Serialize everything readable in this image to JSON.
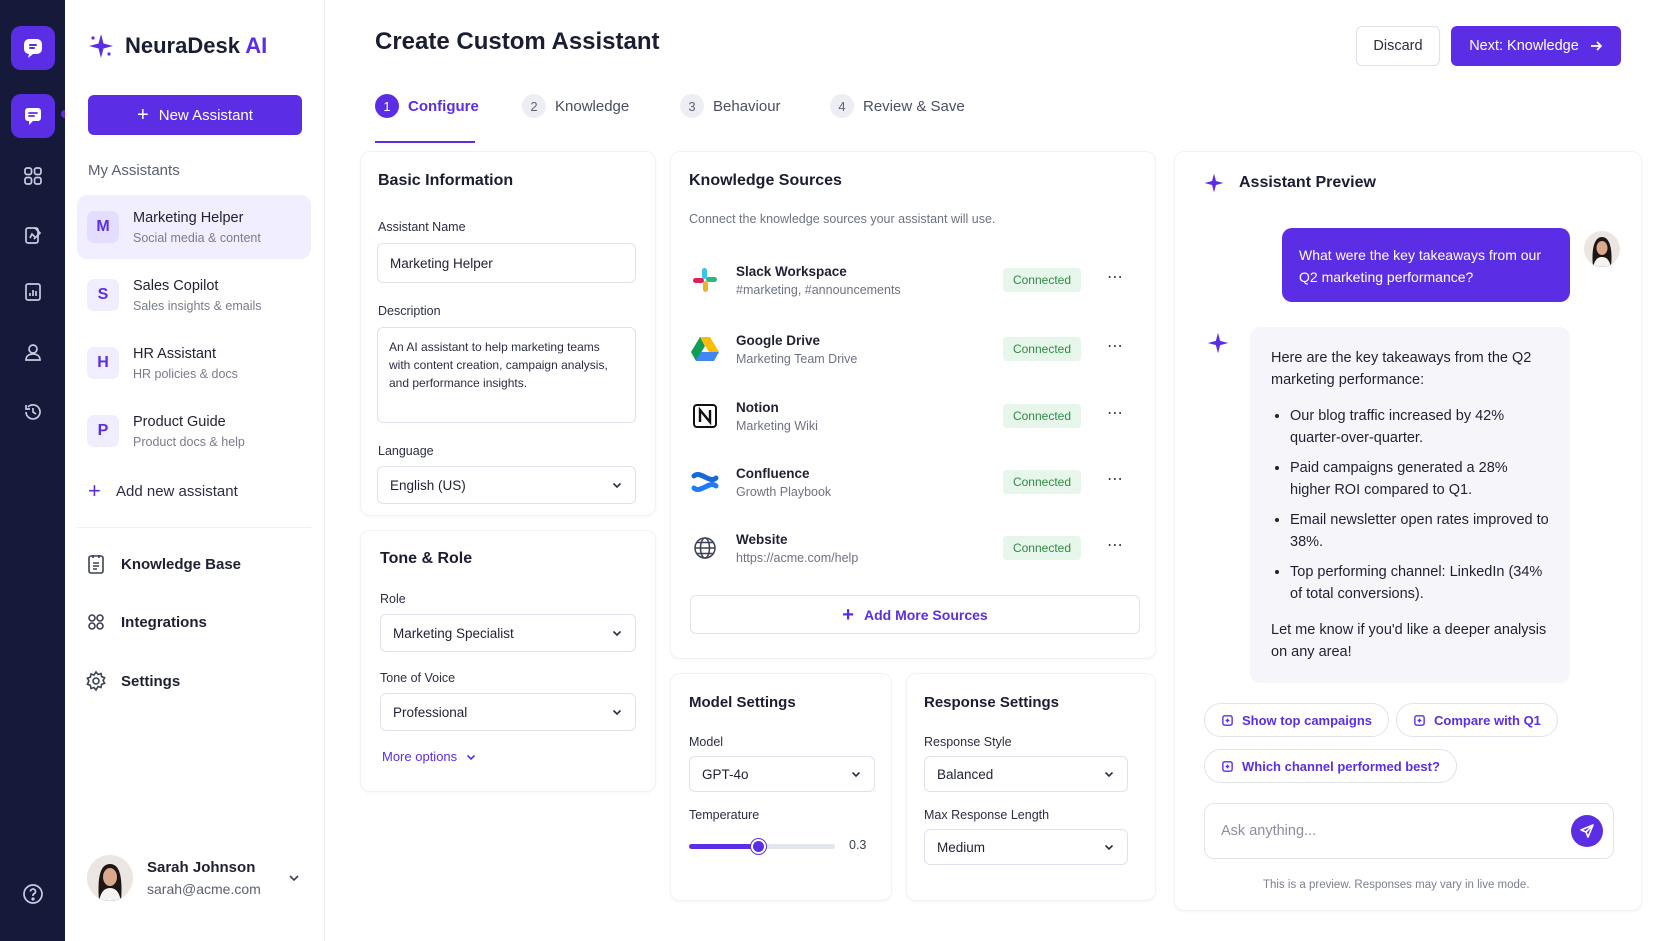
{
  "brand": {
    "name": "NeuraDesk",
    "ai": "AI"
  },
  "sidebar": {
    "new_button": "New Assistant",
    "section_label": "My Assistants",
    "assistants": [
      {
        "initial": "M",
        "name": "Marketing Helper",
        "sub": "Social media & content"
      },
      {
        "initial": "S",
        "name": "Sales Copilot",
        "sub": "Sales insights & emails"
      },
      {
        "initial": "H",
        "name": "HR Assistant",
        "sub": "HR policies & docs"
      },
      {
        "initial": "P",
        "name": "Product Guide",
        "sub": "Product docs & help"
      }
    ],
    "add_assistant": "Add new assistant",
    "nav": [
      "Knowledge Base",
      "Integrations",
      "Settings"
    ],
    "user": {
      "name": "Sarah Johnson",
      "email": "sarah@acme.com"
    }
  },
  "header": {
    "title": "Create Custom Assistant",
    "discard": "Discard",
    "next": "Next: Knowledge"
  },
  "steps": [
    {
      "num": "1",
      "label": "Configure"
    },
    {
      "num": "2",
      "label": "Knowledge"
    },
    {
      "num": "3",
      "label": "Behaviour"
    },
    {
      "num": "4",
      "label": "Review & Save"
    }
  ],
  "basic": {
    "title": "Basic Information",
    "name_label": "Assistant Name",
    "name_value": "Marketing Helper",
    "desc_label": "Description",
    "desc_value": "An AI assistant to help marketing teams with content creation, campaign analysis, and performance insights.",
    "lang_label": "Language",
    "lang_value": "English (US)"
  },
  "tone": {
    "title": "Tone & Role",
    "role_label": "Role",
    "role_value": "Marketing Specialist",
    "voice_label": "Tone of Voice",
    "voice_value": "Professional",
    "more": "More options"
  },
  "knowledge": {
    "title": "Knowledge Sources",
    "subtitle": "Connect the knowledge sources your assistant will use.",
    "sources": [
      {
        "name": "Slack Workspace",
        "sub": "#marketing, #announcements",
        "status": "Connected",
        "icon": "slack-icon"
      },
      {
        "name": "Google Drive",
        "sub": "Marketing Team Drive",
        "status": "Connected",
        "icon": "google-drive-icon"
      },
      {
        "name": "Notion",
        "sub": "Marketing Wiki",
        "status": "Connected",
        "icon": "notion-icon"
      },
      {
        "name": "Confluence",
        "sub": "Growth Playbook",
        "status": "Connected",
        "icon": "confluence-icon"
      },
      {
        "name": "Website",
        "sub": "https://acme.com/help",
        "status": "Connected",
        "icon": "globe-icon"
      }
    ],
    "add_more": "Add More Sources"
  },
  "model": {
    "title": "Model Settings",
    "model_label": "Model",
    "model_value": "GPT-4o",
    "temp_label": "Temperature",
    "temp_value": "0.3",
    "temp_fraction": 0.47
  },
  "response": {
    "title": "Response Settings",
    "style_label": "Response Style",
    "style_value": "Balanced",
    "length_label": "Max Response Length",
    "length_value": "Medium"
  },
  "preview": {
    "title": "Assistant Preview",
    "user_message": "What were the key takeaways from our Q2 marketing performance?",
    "bot_intro": "Here are the key takeaways from the Q2 marketing performance:",
    "bot_points": [
      "Our blog traffic increased by 42% quarter-over-quarter.",
      "Paid campaigns generated a 28% higher ROI compared to Q1.",
      "Email newsletter open rates improved to 38%.",
      "Top performing channel: LinkedIn (34% of total conversions)."
    ],
    "bot_outro": "Let me know if you'd like a deeper analysis on any area!",
    "chips": [
      "Show top campaigns",
      "Compare with Q1",
      "Which channel performed best?"
    ],
    "placeholder": "Ask anything...",
    "footnote": "This is a preview. Responses may vary in live mode."
  },
  "colors": {
    "accent": "#5b2ee6",
    "rail": "#151a3b",
    "success_bg": "#e6f6ea",
    "success_text": "#2f8a45"
  }
}
